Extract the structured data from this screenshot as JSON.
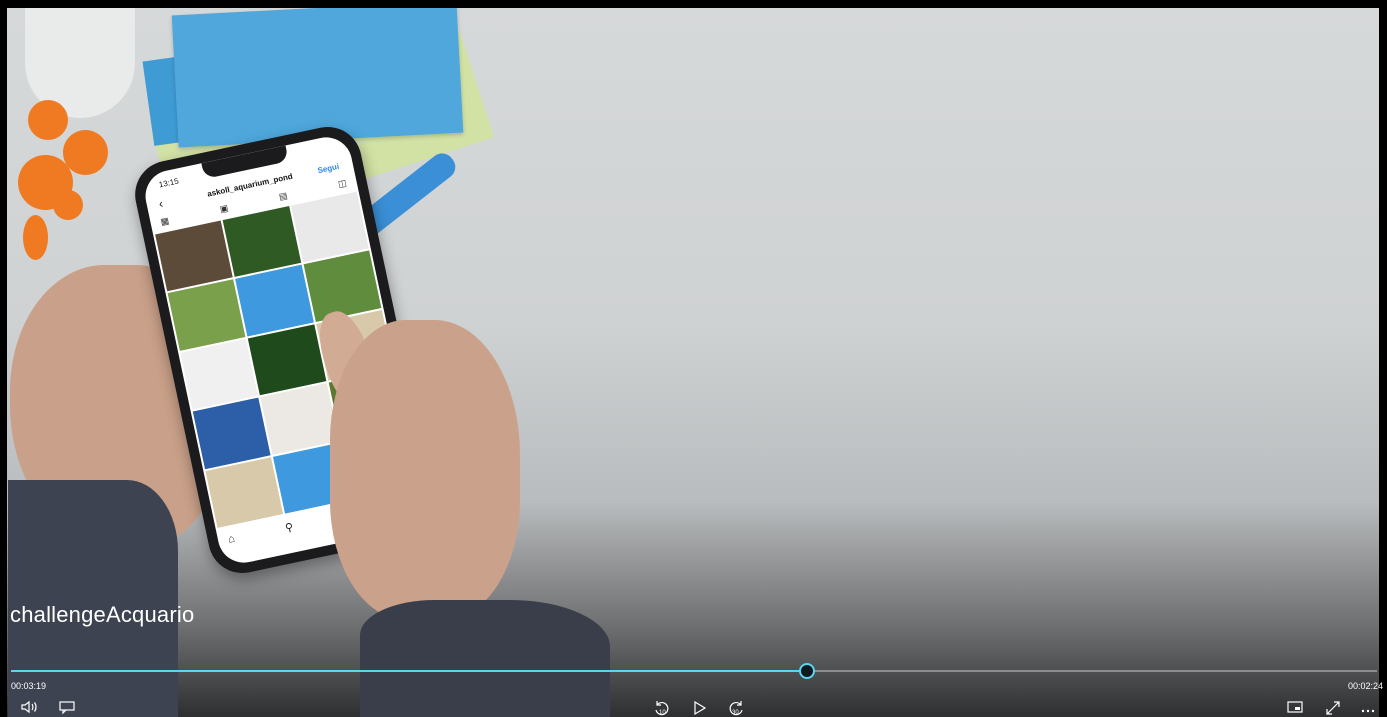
{
  "video": {
    "title": "challengeAcquario",
    "time_elapsed": "00:03:19",
    "time_remaining": "00:02:24",
    "progress_fraction": 0.583
  },
  "phone_screen": {
    "time": "13:15",
    "username": "askoll_aquarium_pond",
    "follow_label": "Segui"
  },
  "controls": {
    "volume_icon": "volume-icon",
    "subtitles_icon": "subtitles-icon",
    "rewind_icon": "skip-back-10-icon",
    "rewind_label": "10",
    "play_icon": "play-icon",
    "forward_icon": "skip-forward-30-icon",
    "forward_label": "30",
    "miniplayer_icon": "mini-player-icon",
    "fullscreen_icon": "fullscreen-icon",
    "more_icon": "more-options-icon"
  },
  "colors": {
    "accent": "#5ad6f0"
  }
}
